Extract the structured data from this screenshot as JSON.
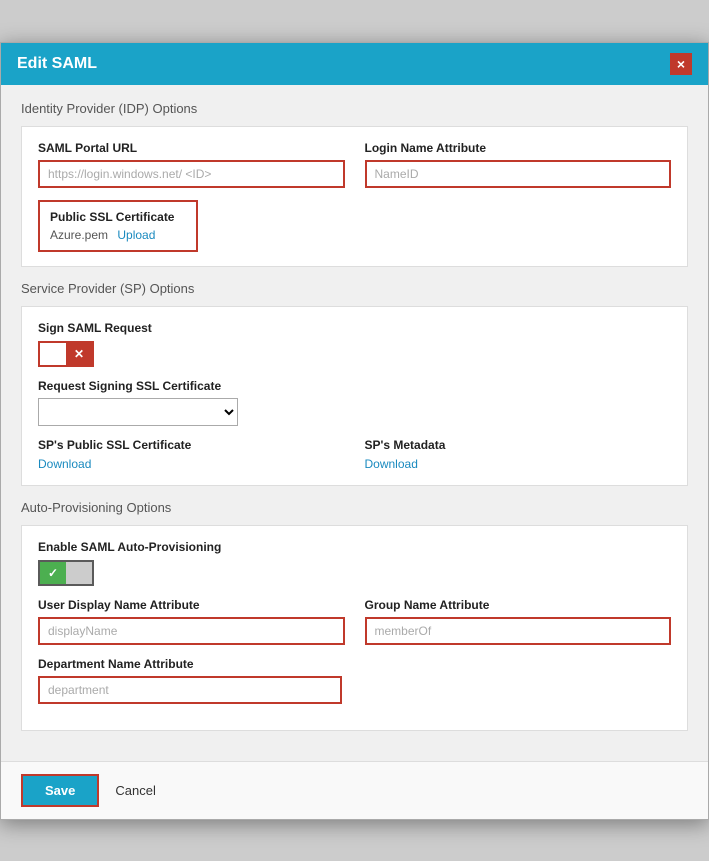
{
  "modal": {
    "title": "Edit SAML",
    "close_label": "×"
  },
  "idp_section": {
    "title": "Identity Provider (IDP) Options",
    "saml_url_label": "SAML Portal URL",
    "saml_url_placeholder": "https://login.windows.net/ <ID>",
    "login_attr_label": "Login Name Attribute",
    "login_attr_placeholder": "NameID",
    "ssl_cert_label": "Public SSL Certificate",
    "ssl_cert_filename": "Azure.pem",
    "ssl_cert_upload": "Upload"
  },
  "sp_section": {
    "title": "Service Provider (SP) Options",
    "sign_saml_label": "Sign SAML Request",
    "toggle_off_icon": "☐",
    "toggle_on_icon": "✕",
    "request_signing_label": "Request Signing SSL Certificate",
    "request_signing_placeholder": "",
    "ssl_cert_label": "SP's Public SSL Certificate",
    "ssl_cert_download": "Download",
    "metadata_label": "SP's Metadata",
    "metadata_download": "Download"
  },
  "auto_prov_section": {
    "title": "Auto-Provisioning Options",
    "enable_label": "Enable SAML Auto-Provisioning",
    "user_display_label": "User Display Name Attribute",
    "user_display_placeholder": "displayName",
    "group_name_label": "Group Name Attribute",
    "group_name_placeholder": "memberOf",
    "dept_name_label": "Department Name Attribute",
    "dept_name_placeholder": "department"
  },
  "footer": {
    "save_label": "Save",
    "cancel_label": "Cancel"
  }
}
